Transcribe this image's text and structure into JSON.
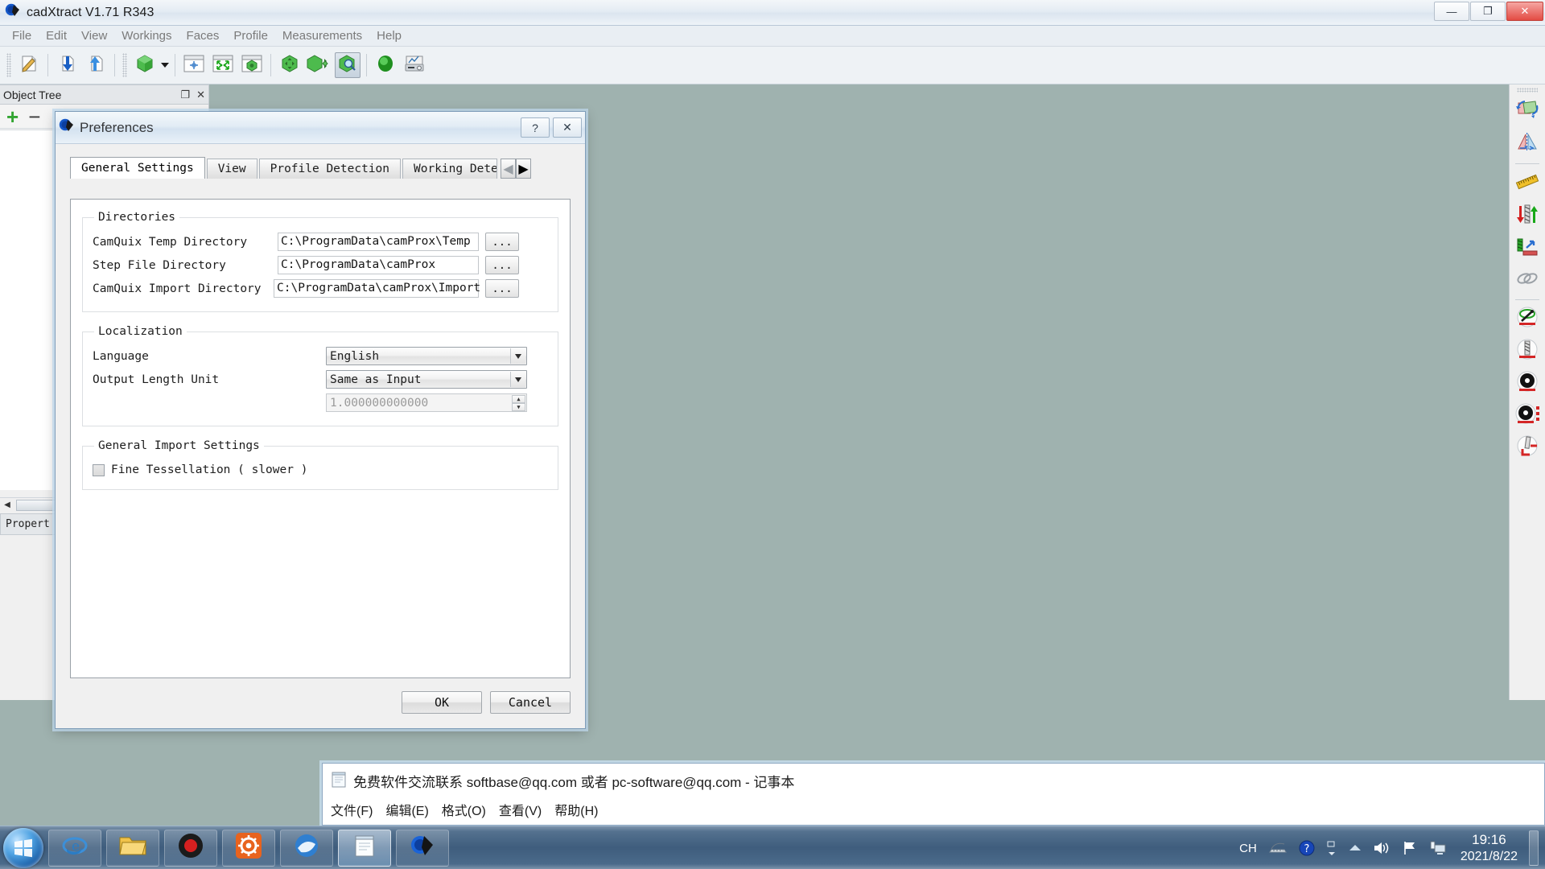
{
  "app": {
    "title": "cadXtract V1.71 R343",
    "icon": "cadxtract-logo-icon",
    "window_controls": [
      {
        "name": "minimize-button",
        "glyph": "—"
      },
      {
        "name": "restore-button",
        "glyph": "❐"
      },
      {
        "name": "close-button",
        "glyph": "✕"
      }
    ],
    "menu": [
      "File",
      "Edit",
      "View",
      "Workings",
      "Faces",
      "Profile",
      "Measurements",
      "Help"
    ],
    "toolbar": [
      {
        "name": "new-sketch-button",
        "icon": "pencil-page-icon"
      },
      {
        "name": "import-button",
        "icon": "down-arrow-page-icon"
      },
      {
        "name": "export-button",
        "icon": "up-arrow-page-icon"
      },
      {
        "name": "solid-view-button",
        "icon": "green-cube-icon"
      },
      {
        "name": "solid-view-dropdown",
        "icon": "chevron-down-icon"
      },
      {
        "name": "fit-center-button",
        "icon": "crosshair-window-icon"
      },
      {
        "name": "zoom-fit-button",
        "icon": "expand-arrows-window-icon"
      },
      {
        "name": "zoom-object-button",
        "icon": "cube-window-icon"
      },
      {
        "name": "pan-button",
        "icon": "cube-move-icon"
      },
      {
        "name": "rotate-button",
        "icon": "cube-rotate-icon"
      },
      {
        "name": "zoom-region-button",
        "icon": "cube-magnifier-icon"
      },
      {
        "name": "render-button",
        "icon": "green-sphere-icon"
      },
      {
        "name": "report-button",
        "icon": "printer-chart-icon"
      }
    ]
  },
  "object_tree": {
    "title": "Object Tree",
    "float_glyph": "❐",
    "close_glyph": "✕",
    "add_glyph": "+",
    "remove_glyph": "−",
    "scroll_left_glyph": "◀",
    "properties_tab": "Propert"
  },
  "right_toolbar": [
    {
      "name": "rotate-part-button",
      "icon": "rotate-part-icon"
    },
    {
      "name": "mirror-part-button",
      "icon": "mirror-part-icon"
    },
    {
      "name": "measure-button",
      "icon": "ruler-icon"
    },
    {
      "name": "depth-direction-button",
      "icon": "up-down-arrows-tool-icon"
    },
    {
      "name": "approach-direction-button",
      "icon": "approach-arrow-icon"
    },
    {
      "name": "chain-link-button",
      "icon": "chain-link-icon"
    },
    {
      "name": "tool-path-button",
      "icon": "toolpath-icon"
    },
    {
      "name": "drill-tool-button",
      "icon": "drill-bit-icon"
    },
    {
      "name": "saw-blade-button",
      "icon": "saw-blade-icon"
    },
    {
      "name": "saw-blade-options-button",
      "icon": "saw-blade-options-icon"
    },
    {
      "name": "corner-tool-button",
      "icon": "corner-tool-icon"
    }
  ],
  "dialog": {
    "title": "Preferences",
    "icon": "cadxtract-logo-icon",
    "help_glyph": "?",
    "close_glyph": "✕",
    "tabs": [
      {
        "label": "General Settings",
        "selected": true
      },
      {
        "label": "View",
        "selected": false
      },
      {
        "label": "Profile Detection",
        "selected": false
      },
      {
        "label": "Working Detec",
        "selected": false,
        "clipped": true
      }
    ],
    "tab_nav": {
      "prev_glyph": "◀",
      "next_glyph": "▶"
    },
    "groups": {
      "directories": {
        "legend": "Directories",
        "browse_label": "...",
        "rows": [
          {
            "label": "CamQuix Temp Directory",
            "value": "C:\\ProgramData\\camProx\\Temp",
            "name": "camquix-temp-directory"
          },
          {
            "label": "Step File Directory",
            "value": "C:\\ProgramData\\camProx",
            "name": "step-file-directory"
          },
          {
            "label": "CamQuix Import Directory",
            "value": "C:\\ProgramData\\camProx\\Import",
            "name": "camquix-import-directory"
          }
        ]
      },
      "localization": {
        "legend": "Localization",
        "language": {
          "label": "Language",
          "value": "English"
        },
        "output_length_unit": {
          "label": "Output Length Unit",
          "value": "Same as Input"
        },
        "scale_factor": {
          "value": "1.000000000000",
          "up_glyph": "▲",
          "down_glyph": "▼"
        },
        "arrow_glyph": "▼"
      },
      "import": {
        "legend": "General Import Settings",
        "fine_tessellation": {
          "label": "Fine Tessellation ( slower )",
          "checked": false
        }
      }
    },
    "buttons": {
      "ok": "OK",
      "cancel": "Cancel"
    }
  },
  "notepad": {
    "icon": "notepad-icon",
    "title": "免费软件交流联系 softbase@qq.com 或者 pc-software@qq.com - 记事本",
    "menu": [
      "文件(F)",
      "编辑(E)",
      "格式(O)",
      "查看(V)",
      "帮助(H)"
    ]
  },
  "taskbar": {
    "start_button": "start-orb",
    "items": [
      {
        "name": "taskbar-internet-explorer",
        "icon": "internet-explorer-icon"
      },
      {
        "name": "taskbar-file-explorer",
        "icon": "file-explorer-icon"
      },
      {
        "name": "taskbar-recorder",
        "icon": "record-circle-icon"
      },
      {
        "name": "taskbar-settings-app",
        "icon": "orange-gear-icon"
      },
      {
        "name": "taskbar-browser",
        "icon": "blue-browser-icon"
      },
      {
        "name": "taskbar-notepad",
        "icon": "notepad-icon",
        "active": true
      },
      {
        "name": "taskbar-cadxtract",
        "icon": "cadxtract-logo-icon",
        "active": false
      }
    ],
    "tray": {
      "input_language": "CH",
      "icons": [
        {
          "name": "keyboard-icon"
        },
        {
          "name": "help-question-icon"
        },
        {
          "name": "window-switch-icon"
        },
        {
          "name": "show-hidden-icons-icon"
        },
        {
          "name": "volume-icon"
        },
        {
          "name": "action-center-flag-icon"
        },
        {
          "name": "network-monitor-icon"
        }
      ],
      "time": "19:16",
      "date": "2021/8/22"
    }
  }
}
